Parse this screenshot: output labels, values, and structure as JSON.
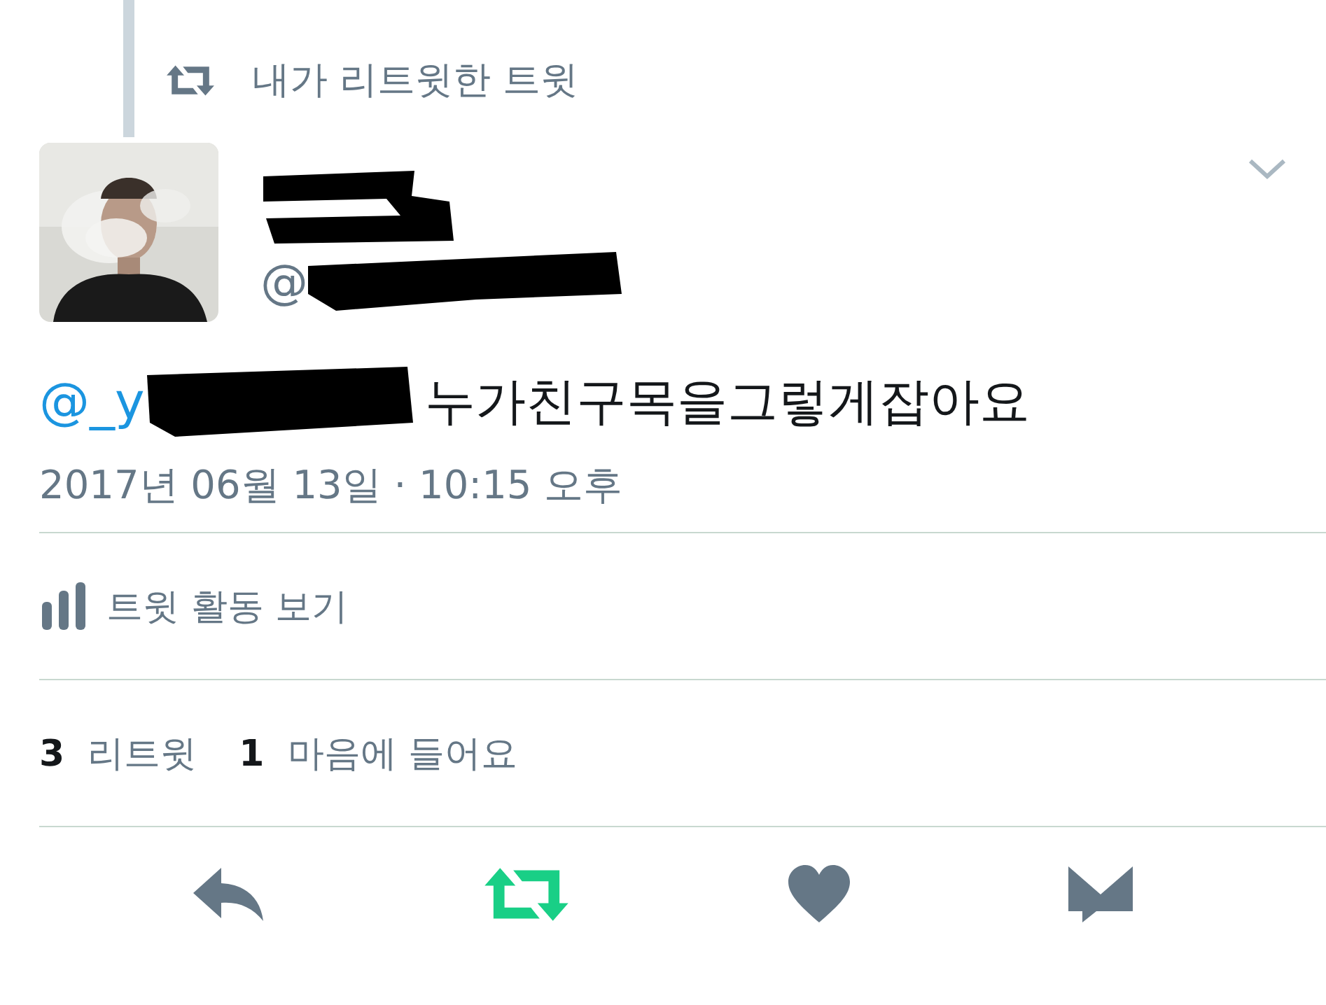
{
  "context": {
    "label": "내가 리트윗한 트윗"
  },
  "author": {
    "handle": "@"
  },
  "tweet": {
    "mention": "@_y",
    "text": "누가친구목을그렇게잡아요",
    "timestamp": "2017년 06월 13일 · 10:15 오후"
  },
  "activity_link": "트윗 활동 보기",
  "stats": [
    {
      "count": "3",
      "label": "리트윗"
    },
    {
      "count": "1",
      "label": "마음에 들어요"
    }
  ],
  "actions": [
    {
      "kind": "reply",
      "active": false
    },
    {
      "kind": "retweet",
      "active": true
    },
    {
      "kind": "like",
      "active": false
    },
    {
      "kind": "message",
      "active": false
    }
  ]
}
